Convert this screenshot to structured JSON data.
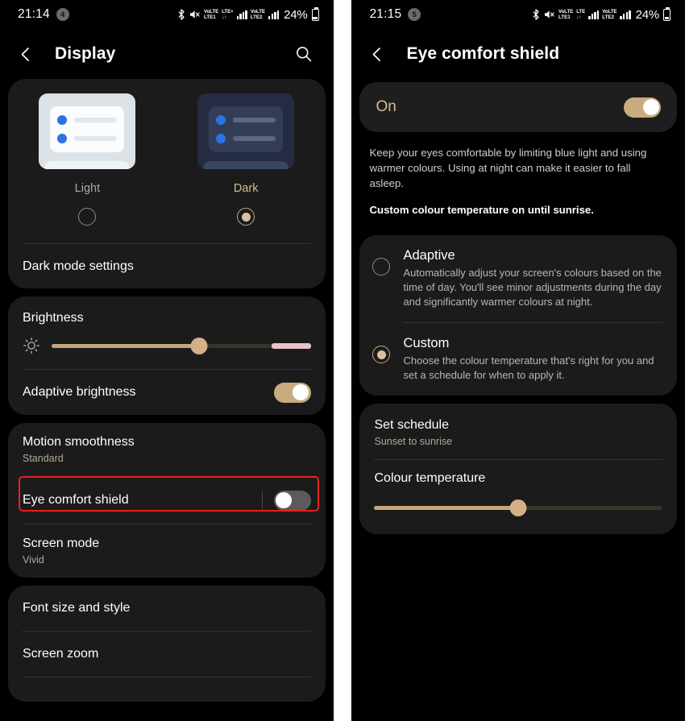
{
  "left": {
    "status": {
      "time": "21:14",
      "notification_count": "4",
      "icons": [
        "bluetooth-icon",
        "mute-icon",
        "volte1-lteplus-icon",
        "signal-bars-icon",
        "volte2-icon",
        "signal-bars-icon"
      ],
      "sim1_top": "VoLTE",
      "sim1_bottom": "LTE1",
      "net1_top": "LTE+",
      "net1_bottom": "↓↑",
      "sim2_top": "VoLTE",
      "sim2_bottom": "LTE2",
      "battery_percent": "24%"
    },
    "appbar": {
      "title": "Display",
      "back": "back-arrow",
      "search": "search-icon"
    },
    "theme": {
      "light": {
        "label": "Light",
        "selected": false
      },
      "dark": {
        "label": "Dark",
        "selected": true
      },
      "dark_mode_settings": "Dark mode settings"
    },
    "brightness": {
      "title": "Brightness",
      "value_percent": 57,
      "pink_start_percent": 85,
      "adaptive_label": "Adaptive brightness",
      "adaptive_on": true
    },
    "motion": {
      "title": "Motion smoothness",
      "subtitle": "Standard"
    },
    "eye_comfort": {
      "title": "Eye comfort shield",
      "toggle_on": false,
      "highlighted": true
    },
    "screen_mode": {
      "title": "Screen mode",
      "subtitle": "Vivid"
    },
    "bottom_items": [
      {
        "label": "Font size and style"
      },
      {
        "label": "Screen zoom"
      }
    ]
  },
  "right": {
    "status": {
      "time": "21:15",
      "notification_count": "5",
      "sim1_top": "VoLTE",
      "sim1_bottom": "LTE1",
      "net1_top": "LTE",
      "net1_bottom": "↓↑",
      "sim2_top": "VoLTE",
      "sim2_bottom": "LTE2",
      "battery_percent": "24%"
    },
    "appbar": {
      "title": "Eye comfort shield",
      "back": "back-arrow"
    },
    "master": {
      "label": "On",
      "toggle_on": true
    },
    "description": "Keep your eyes comfortable by limiting blue light and using warmer colours. Using at night can make it easier to fall asleep.",
    "status_note": "Custom colour temperature on until sunrise.",
    "options": [
      {
        "title": "Adaptive",
        "description": "Automatically adjust your screen's colours based on the time of day. You'll see minor adjustments during the day and significantly warmer colours at night.",
        "selected": false
      },
      {
        "title": "Custom",
        "description": "Choose the colour temperature that's right for you and set a schedule for when to apply it.",
        "selected": true
      }
    ],
    "schedule": {
      "title": "Set schedule",
      "subtitle": "Sunset to sunrise"
    },
    "colour_temperature": {
      "title": "Colour temperature",
      "value_percent": 50
    }
  },
  "colors": {
    "accent": "#c9ab80",
    "highlight": "#e8201e",
    "card": "#1b1b1b",
    "background": "#000000"
  }
}
